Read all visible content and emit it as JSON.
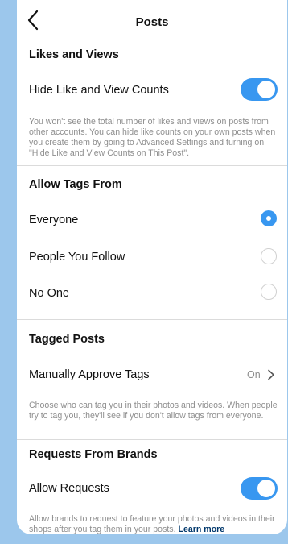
{
  "nav": {
    "title": "Posts"
  },
  "likes_views": {
    "title": "Likes and Views",
    "hide_counts_label": "Hide Like and View Counts",
    "hide_counts_on": true,
    "description": "You won't see the total number of likes and views on posts from other accounts. You can hide like counts on your own posts when you create them by going to Advanced Settings and turning on \"Hide Like and View Counts on This Post\"."
  },
  "allow_tags": {
    "title": "Allow Tags From",
    "options": [
      {
        "label": "Everyone",
        "selected": true
      },
      {
        "label": "People You Follow",
        "selected": false
      },
      {
        "label": "No One",
        "selected": false
      }
    ]
  },
  "tagged_posts": {
    "title": "Tagged Posts",
    "approve_label": "Manually Approve Tags",
    "approve_value": "On",
    "description": "Choose who can tag you in their photos and videos. When people try to tag you, they'll see if you don't allow tags from everyone."
  },
  "brands": {
    "title": "Requests From Brands",
    "allow_label": "Allow Requests",
    "allow_on": true,
    "description": "Allow brands to request to feature your photos and videos in their shops after you tag them in your posts.",
    "learn_more": "Learn more"
  },
  "colors": {
    "accent": "#3897f0",
    "background": "#9cc7ec"
  }
}
